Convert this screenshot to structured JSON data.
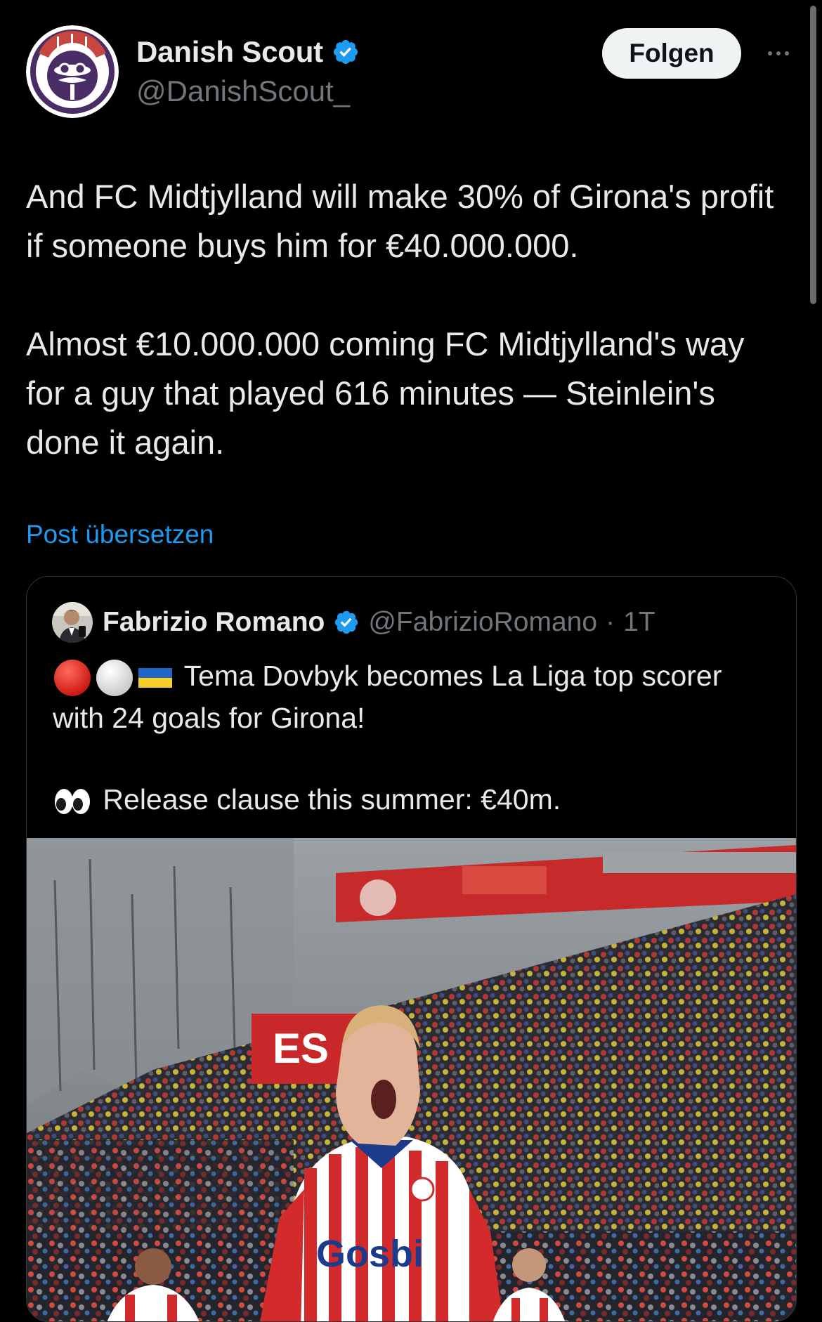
{
  "post": {
    "author": {
      "name": "Danish Scout",
      "handle": "@DanishScout_",
      "verified": true
    },
    "follow_label": "Folgen",
    "more_label": "···",
    "paragraphs": [
      "And FC Midtjylland will make 30% of Girona's profit if someone buys him for €40.000.000.",
      "Almost €10.000.000 coming FC Midtjylland's way for a guy that played 616 minutes — Steinlein's done it again."
    ],
    "translate_label": "Post übersetzen"
  },
  "quote": {
    "author": {
      "name": "Fabrizio Romano",
      "handle": "@FabrizioRomano",
      "separator": "·",
      "time": "1T",
      "verified": true
    },
    "line1": "Tema Dovbyk becomes La Liga top scorer with 24 goals for Girona!",
    "line2": "Release clause this summer: €40m.",
    "image": {
      "banner_text": "ES",
      "shirt_sponsor": "Gosbi"
    }
  },
  "colors": {
    "background": "#000000",
    "text": "#e7e9ea",
    "muted": "#71767b",
    "link": "#1d9bf0",
    "verified": "#1d9bf0",
    "follow_bg": "#eff3f4",
    "card_border": "#2f3336"
  }
}
